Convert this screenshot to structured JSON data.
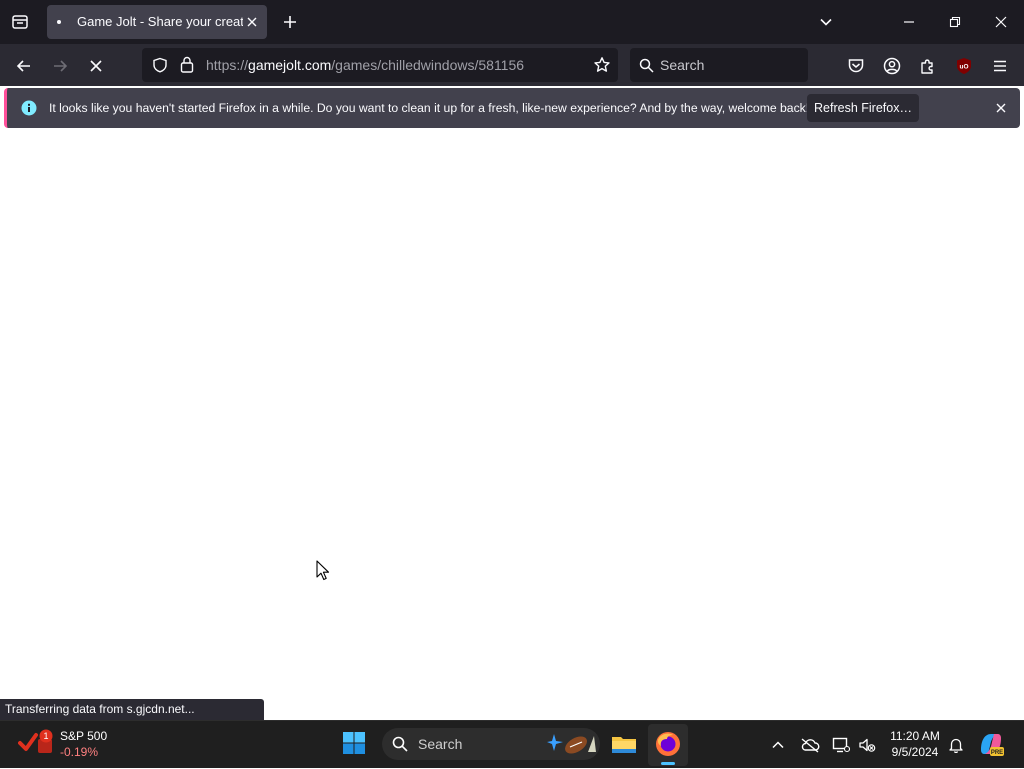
{
  "browser": {
    "tab": {
      "title": "Game Jolt - Share your creations"
    },
    "url": {
      "scheme": "https://",
      "host": "gamejolt.com",
      "path": "/games/chilledwindows/581156"
    },
    "search_placeholder": "Search",
    "notification": {
      "text": "It looks like you haven't started Firefox in a while. Do you want to clean it up for a fresh, like-new experience? And by the way, welcome back!",
      "button": "Refresh Firefox…"
    },
    "status_text": "Transferring data from s.gjcdn.net..."
  },
  "taskbar": {
    "stock": {
      "name": "S&P 500",
      "change": "-0.19%",
      "badge": "1"
    },
    "search_placeholder": "Search",
    "clock": {
      "time": "11:20 AM",
      "date": "9/5/2024"
    }
  },
  "colors": {
    "accent": "#ff4f9a",
    "info": "#80ebff",
    "stock_down": "#ff8080"
  }
}
